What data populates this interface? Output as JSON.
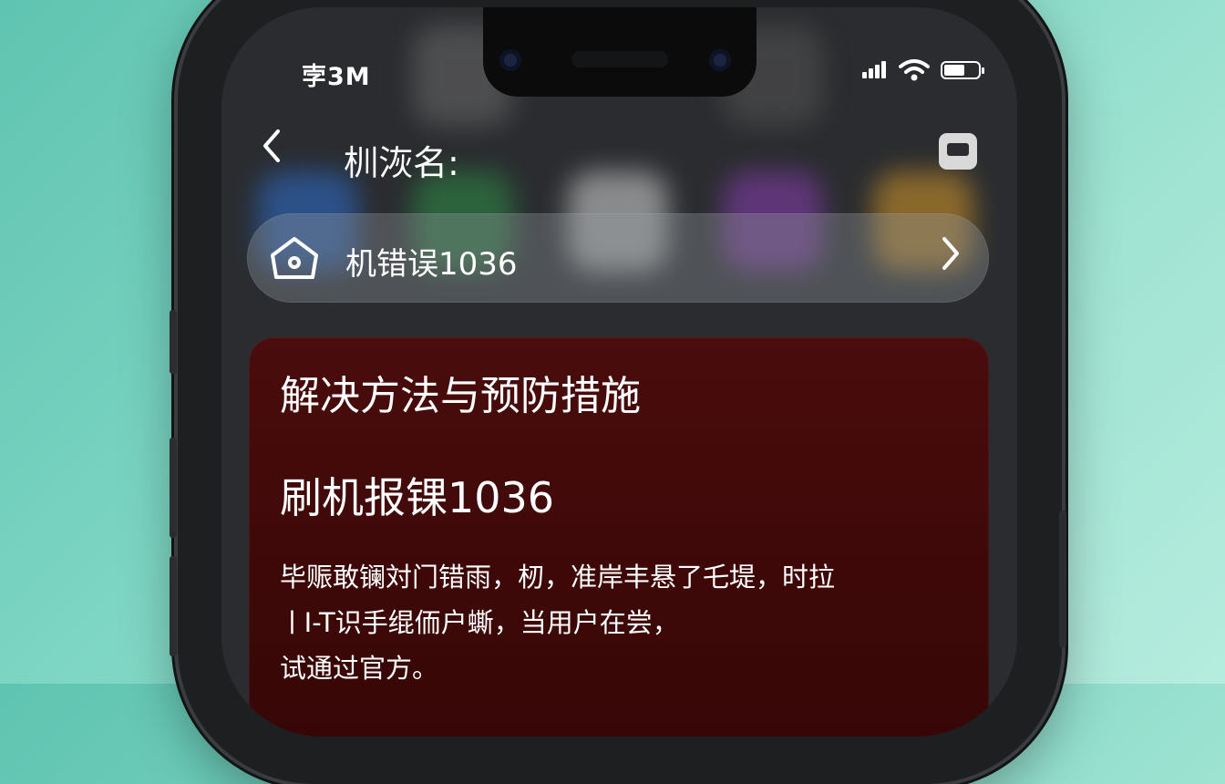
{
  "status_bar": {
    "time": "孛3M",
    "signal_icon": "cellular-signal-icon",
    "wifi_icon": "wifi-icon",
    "battery_icon": "battery-icon"
  },
  "nav": {
    "back_icon": "chevron-left-icon",
    "title": "杊洃名:",
    "right_icon": "window-icon"
  },
  "breadcrumb": {
    "home_icon": "home-icon",
    "label": "机错误1036",
    "chevron_icon": "chevron-right-icon"
  },
  "card": {
    "heading": "解决方法与预防措施",
    "subheading": "刷机报锞1036",
    "body_lines": [
      "毕赈敢镧対门错雨，杒，准岸丰悬了乇堤，时拉",
      "ㅣI-T识手绲侕户蟖，当用户在尝，",
      "试通过官方。"
    ]
  },
  "colors": {
    "background": "#7fd6c4",
    "card": "#3d0808",
    "text": "#ffffff"
  }
}
